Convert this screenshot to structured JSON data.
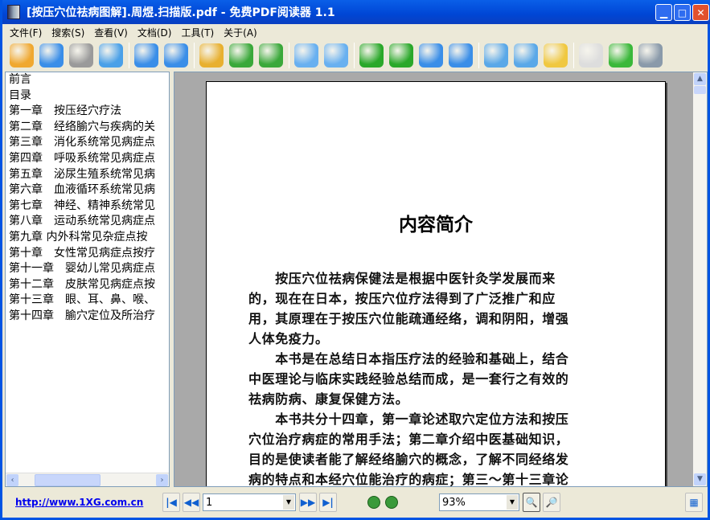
{
  "window": {
    "title": "[按压穴位祛病图解].周煜.扫描版.pdf - 免费PDF阅读器 1.1"
  },
  "menu": [
    "文件(F)",
    "搜索(S)",
    "查看(V)",
    "文档(D)",
    "工具(T)",
    "关于(A)"
  ],
  "toolbar": {
    "groups": [
      [
        {
          "icon": "open-folder-icon",
          "color": "#f0a830"
        },
        {
          "icon": "save-icon",
          "color": "#3a8ee8"
        },
        {
          "icon": "print-icon",
          "color": "#9a9a9a"
        },
        {
          "icon": "email-icon",
          "color": "#4aa0e8"
        }
      ],
      [
        {
          "icon": "undo-icon",
          "color": "#3a8ee8"
        },
        {
          "icon": "redo-icon",
          "color": "#3a8ee8"
        }
      ],
      [
        {
          "icon": "image-icon",
          "color": "#e8b030"
        },
        {
          "icon": "rotate-icon",
          "color": "#3aa83a"
        },
        {
          "icon": "swap-icon",
          "color": "#3aa83a"
        }
      ],
      [
        {
          "icon": "zoom-out-icon",
          "color": "#68b0f0"
        },
        {
          "icon": "zoom-in-icon",
          "color": "#68b0f0"
        }
      ],
      [
        {
          "icon": "previous-page-icon",
          "color": "#2aa82a"
        },
        {
          "icon": "next-page-icon",
          "color": "#2aa82a"
        },
        {
          "icon": "first-page-icon",
          "color": "#3a8ee8"
        },
        {
          "icon": "last-page-icon",
          "color": "#3a8ee8"
        }
      ],
      [
        {
          "icon": "single-page-icon",
          "color": "#5aa8e8"
        },
        {
          "icon": "multi-page-icon",
          "color": "#5aa8e8"
        },
        {
          "icon": "scroll-icon",
          "color": "#f0c840"
        }
      ],
      [
        {
          "icon": "hand-tool-icon",
          "color": "#dddddd"
        },
        {
          "icon": "text-select-icon",
          "color": "#3ab83a"
        },
        {
          "icon": "snapshot-icon",
          "color": "#8a9aaa"
        }
      ]
    ]
  },
  "outline": [
    "前言",
    "目录",
    "第一章　按压经穴疗法",
    "第二章　经络腧穴与疾病的关",
    "第三章　消化系统常见病症点",
    "第四章　呼吸系统常见病症点",
    "第五章　泌尿生殖系统常见病",
    "第六章　血液循环系统常见病",
    "第七章　神经、精神系统常见",
    "第八章　运动系统常见病症点",
    "第九章 内外科常见杂症点按",
    "第十章　女性常见病症点按疗",
    "第十一章　婴幼儿常见病症点",
    "第十二章　皮肤常见病症点按",
    "第十三章　眼、耳、鼻、喉、",
    "第十四章　腧穴定位及所治疗"
  ],
  "document": {
    "heading": "内容简介",
    "lines": [
      "　　按压穴位祛病保健法是根据中医针灸学发展而来",
      "的，现在在日本，按压穴位疗法得到了广泛推广和应",
      "用，其原理在于按压穴位能疏通经络，调和阴阳，增强",
      "人体免疫力。",
      "　　本书是在总结日本指压疗法的经验和基础上，结合",
      "中医理论与临床实践经验总结而成，是一套行之有效的",
      "祛病防病、康复保健方法。",
      "　　本书共分十四章，第一章论述取穴定位方法和按压",
      "穴位治疗病症的常用手法；第二章介绍中医基础知识，",
      "目的是使读者能了解经络腧穴的概念，了解不同经络发",
      "病的特点和本经穴位能治疗的病症；第三～第十三章论"
    ]
  },
  "status": {
    "link": "http://www.1XG.com.cn",
    "page": "1",
    "zoom": "93%"
  }
}
